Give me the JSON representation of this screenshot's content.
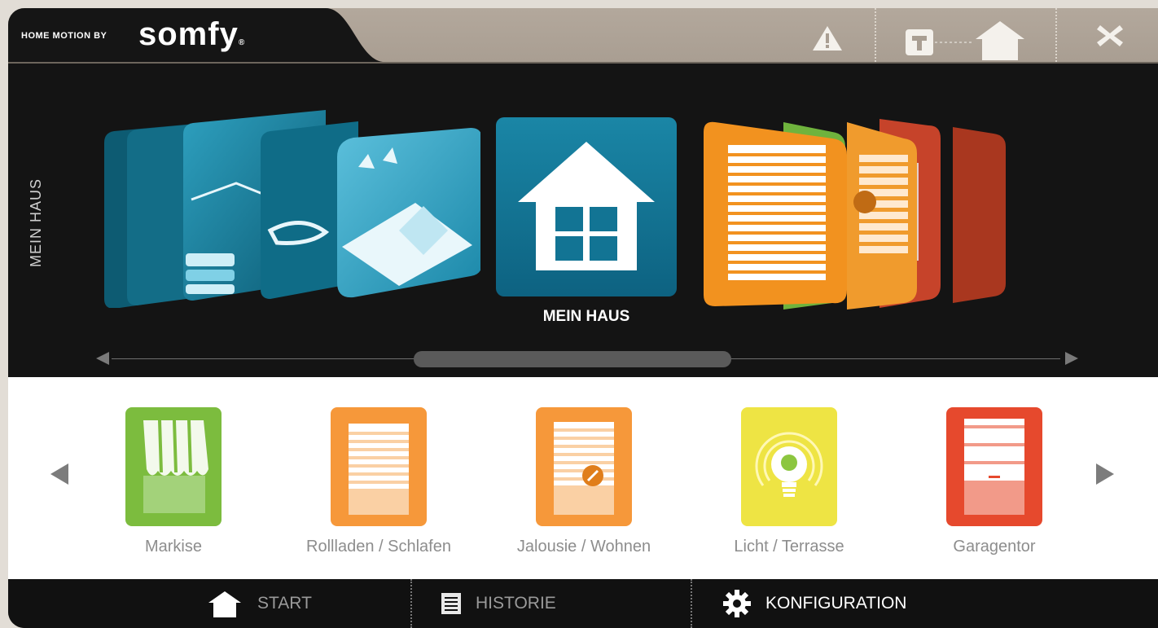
{
  "header": {
    "brand_prefix": "HOME MOTION BY",
    "brand_name": "somfy",
    "brand_reg": "®",
    "icons": [
      "warning-icon",
      "tahoma-home-icon",
      "close-icon"
    ]
  },
  "carousel": {
    "side_label": "MEIN HAUS",
    "current_label": "MEIN HAUS",
    "colors": {
      "blue": "#0f7391",
      "orange": "#f2921f",
      "green": "#6db33f",
      "red": "#d9452c"
    }
  },
  "devices": {
    "items": [
      {
        "label": "Markise",
        "color": "#7cbc3e",
        "icon": "awning-icon"
      },
      {
        "label": "Rollladen / Schlafen",
        "color": "#f6983a",
        "icon": "roller-shutter-icon"
      },
      {
        "label": "Jalousie / Wohnen",
        "color": "#f6983a",
        "icon": "venetian-blind-icon"
      },
      {
        "label": "Licht / Terrasse",
        "color": "#eee444",
        "icon": "light-bulb-icon"
      },
      {
        "label": "Garagentor",
        "color": "#e6492d",
        "icon": "garage-door-icon"
      }
    ]
  },
  "bottom_nav": {
    "start": "START",
    "historie": "HISTORIE",
    "konfiguration": "KONFIGURATION"
  }
}
